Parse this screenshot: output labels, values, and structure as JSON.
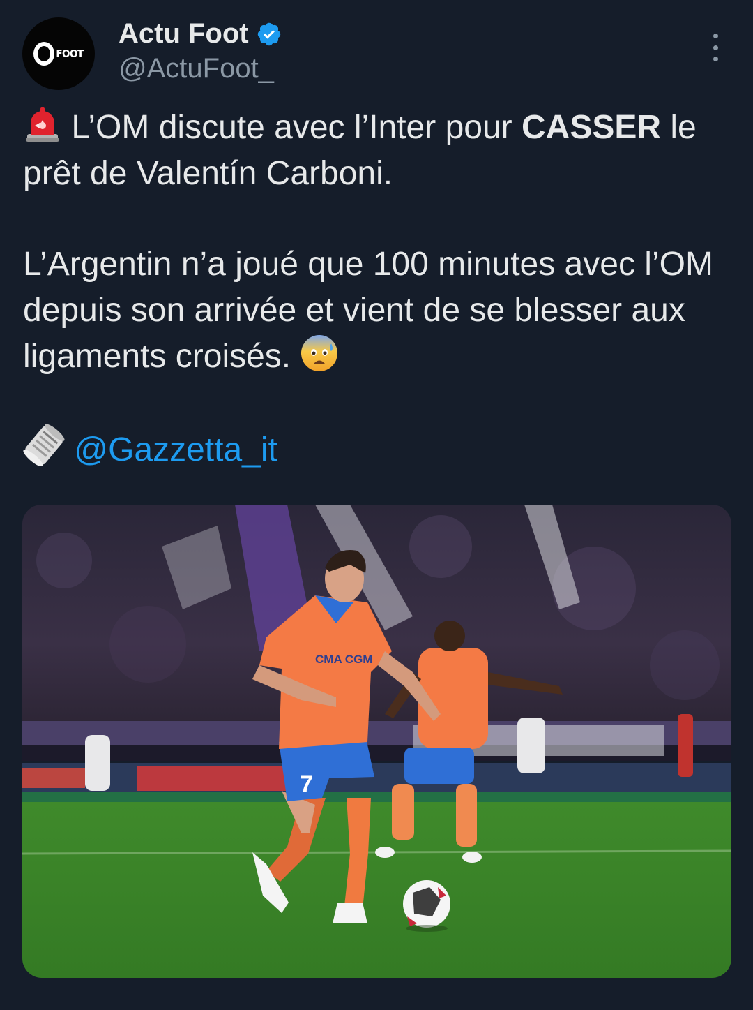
{
  "account": {
    "display_name": "Actu Foot",
    "handle": "@ActuFoot_",
    "avatar_text": "FOOT",
    "verified_icon": "verified-badge-icon",
    "verified_color": "#1d9bf0"
  },
  "tweet": {
    "line1_prefix": "L’OM discute avec l’Inter pour ",
    "line1_emphasis": "CASSER",
    "line1_suffix": " le prêt de Valentín Carboni.",
    "paragraph2": "L’Argentin n’a joué que 100 minutes avec l’OM depuis son arrivée et vient de se blesser aux ligaments croisés.",
    "source_mention": "@Gazzetta_it",
    "emoji": {
      "siren": "siren-emoji",
      "anxious": "anxious-face-emoji",
      "newspaper": "rolled-newspaper-emoji"
    }
  },
  "media": {
    "jersey_text": "CMA CGM",
    "shirt_number": "7"
  },
  "colors": {
    "background": "#151d2a",
    "text": "#e7e9ea",
    "secondary": "#8b98a5",
    "link": "#1d9bf0",
    "kit_orange": "#f47a45",
    "kit_blue": "#2f6fd6",
    "pitch": "#3d8a2c"
  }
}
